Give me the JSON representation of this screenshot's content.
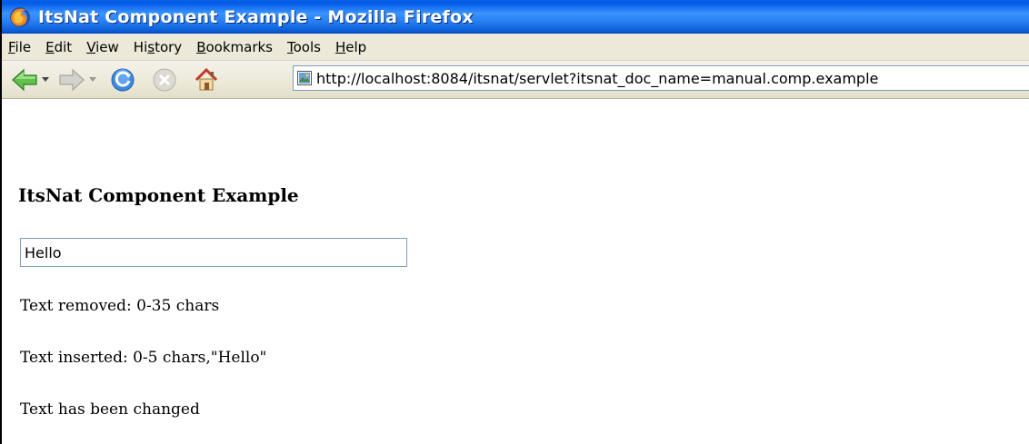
{
  "window": {
    "title": "ItsNat Component Example - Mozilla Firefox"
  },
  "menubar": {
    "items": [
      {
        "accel": "F",
        "rest": "ile"
      },
      {
        "accel": "E",
        "rest": "dit"
      },
      {
        "accel": "V",
        "rest": "iew"
      },
      {
        "pre": "Hi",
        "accel": "s",
        "rest": "tory"
      },
      {
        "accel": "B",
        "rest": "ookmarks"
      },
      {
        "accel": "T",
        "rest": "ools"
      },
      {
        "accel": "H",
        "rest": "elp"
      }
    ]
  },
  "navbar": {
    "url": "http://localhost:8084/itsnat/servlet?itsnat_doc_name=manual.comp.example"
  },
  "page": {
    "heading": "ItsNat Component Example",
    "input_value": "Hello",
    "messages": [
      "Text removed: 0-35 chars",
      "Text inserted: 0-5 chars,\"Hello\"",
      "Text has been changed"
    ]
  },
  "colors": {
    "titlebar": "#0058e6",
    "chrome": "#ece9d8",
    "input_border": "#7f9db9"
  }
}
